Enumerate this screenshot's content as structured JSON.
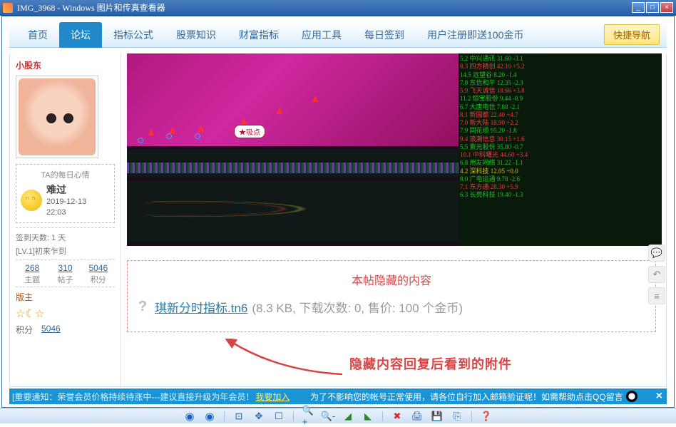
{
  "window": {
    "title": "IMG_3968 - Windows 图片和传真查看器",
    "min": "_",
    "max": "□",
    "close": "×"
  },
  "nav": {
    "items": [
      "首页",
      "论坛",
      "指标公式",
      "股票知识",
      "财富指标",
      "应用工具",
      "每日签到",
      "用户注册即送100金币"
    ],
    "active_index": 1,
    "quicknav": "快捷导航"
  },
  "user": {
    "name": "小股东",
    "mood_header": "TA的每日心情",
    "mood_name": "难过",
    "mood_date": "2019-12-13",
    "mood_time": "22:03",
    "signin_days": "签到天数: 1 天",
    "level": "[LV.1]初来乍到",
    "stats": [
      {
        "n": "268",
        "l": "主题"
      },
      {
        "n": "310",
        "l": "帖子"
      },
      {
        "n": "5046",
        "l": "积分"
      }
    ],
    "owner": "版主",
    "icon_glyphs": "☆☾☆",
    "points_label": "积分",
    "points_value": "5046"
  },
  "chart": {
    "annotation": "★吸点"
  },
  "hidden": {
    "title": "本帖隐藏的内容",
    "qmark": "?",
    "filename": "琪新分时指标.tn6",
    "info": "(8.3 KB, 下载次数: 0, 售价: 100 个金币)"
  },
  "callout": "隐藏内容回复后看到的附件",
  "notice": {
    "lead": "[重要通知：荣誉会员价格持续待涨中---建议直接升级为年会员！",
    "link1": "我要加入",
    "gap": "        ",
    "t2": "为了不影响您的帐号正常使用，请各位自行加入邮箱验证呢！如需帮助点击QQ留言",
    "close": "×"
  },
  "floaters": {
    "speech": "💬",
    "back": "↶",
    "menu": "≡"
  },
  "bottom_icons": [
    "◉",
    "◉",
    "|",
    "⊡",
    "✥",
    "☐",
    "|",
    "🔍+",
    "🔍-",
    "◢",
    "◣",
    "|",
    "✖",
    "🖨",
    "💾",
    "⎘",
    "|",
    "❓"
  ]
}
